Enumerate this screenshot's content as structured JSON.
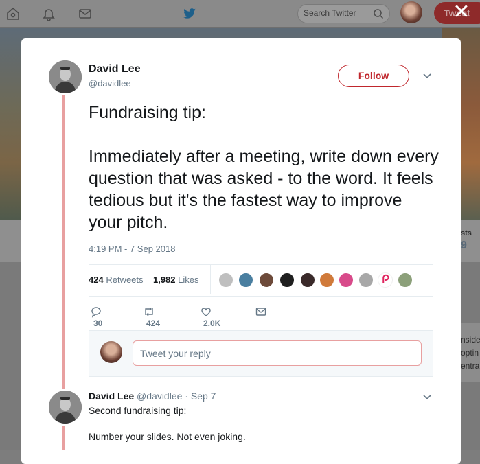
{
  "nav": {
    "search_placeholder": "Search Twitter",
    "tweet_button": "Tweet"
  },
  "background": {
    "stat_label": "sts",
    "stat_value": "9",
    "side_lines": [
      "nside",
      "optin",
      "entral"
    ]
  },
  "tweet": {
    "author_name": "David Lee",
    "author_handle": "@davidlee",
    "follow_label": "Follow",
    "text": "Fundraising tip:\n\nImmediately after a meeting, write down every question that was asked - to the word. It feels tedious but it's the fastest way to improve your pitch.",
    "timestamp": "4:19 PM - 7 Sep 2018",
    "retweets_count": "424",
    "retweets_label": "Retweets",
    "likes_count": "1,982",
    "likes_label": "Likes",
    "actions": {
      "replies": "30",
      "retweets": "424",
      "likes": "2.0K"
    }
  },
  "reply_box": {
    "placeholder": "Tweet your reply"
  },
  "reply_tweet": {
    "author_name": "David Lee",
    "meta": "@davidlee · Sep 7",
    "line1": "Second fundraising tip:",
    "line2": "Number your slides. Not even joking."
  },
  "colors": {
    "accent": "#c0272d",
    "thread": "#e8a0a0",
    "muted": "#657786"
  }
}
